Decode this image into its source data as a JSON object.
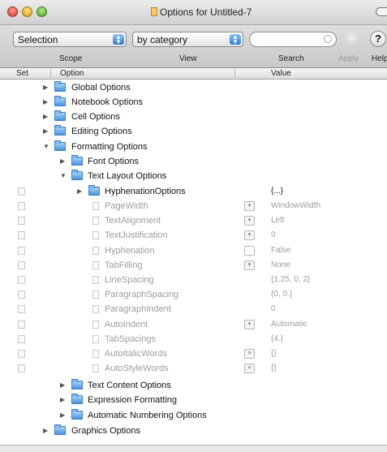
{
  "window": {
    "title": "Options for Untitled-7"
  },
  "toolbar": {
    "scope_value": "Selection",
    "view_value": "by category",
    "search_value": "",
    "scope_label": "Scope",
    "view_label": "View",
    "search_label": "Search",
    "apply_label": "Apply",
    "help_label": "Help",
    "help_glyph": "?"
  },
  "columns": {
    "set": "Set",
    "option": "Option",
    "value": "Value"
  },
  "tree": {
    "global": "Global Options",
    "notebook": "Notebook Options",
    "cell": "Cell Options",
    "editing": "Editing Options",
    "formatting": "Formatting Options",
    "font": "Font Options",
    "text_layout": "Text Layout Options",
    "hyphenation_options": "HyphenationOptions",
    "hyphenation_options_value": "{...}",
    "text_content": "Text Content Options",
    "expression": "Expression Formatting",
    "auto_numbering": "Automatic Numbering Options",
    "graphics": "Graphics Options"
  },
  "options": [
    {
      "name": "PageWidth",
      "value": "WindowWidth",
      "control": "popup"
    },
    {
      "name": "TextAlignment",
      "value": "Left",
      "control": "popup"
    },
    {
      "name": "TextJustification",
      "value": "0",
      "control": "popup"
    },
    {
      "name": "Hyphenation",
      "value": "False",
      "control": "checkbox"
    },
    {
      "name": "TabFilling",
      "value": "None",
      "control": "popup"
    },
    {
      "name": "LineSpacing",
      "value": "{1.25, 0, 2}",
      "control": "none"
    },
    {
      "name": "ParagraphSpacing",
      "value": "{0, 0.}",
      "control": "none"
    },
    {
      "name": "ParagraphIndent",
      "value": "0",
      "control": "none"
    },
    {
      "name": "AutoIndent",
      "value": "Automatic",
      "control": "popup"
    },
    {
      "name": "TabSpacings",
      "value": "{4.}",
      "control": "none"
    },
    {
      "name": "AutoItalicWords",
      "value": "{}",
      "control": "list"
    },
    {
      "name": "AutoStyleWords",
      "value": "{}",
      "control": "list"
    }
  ]
}
